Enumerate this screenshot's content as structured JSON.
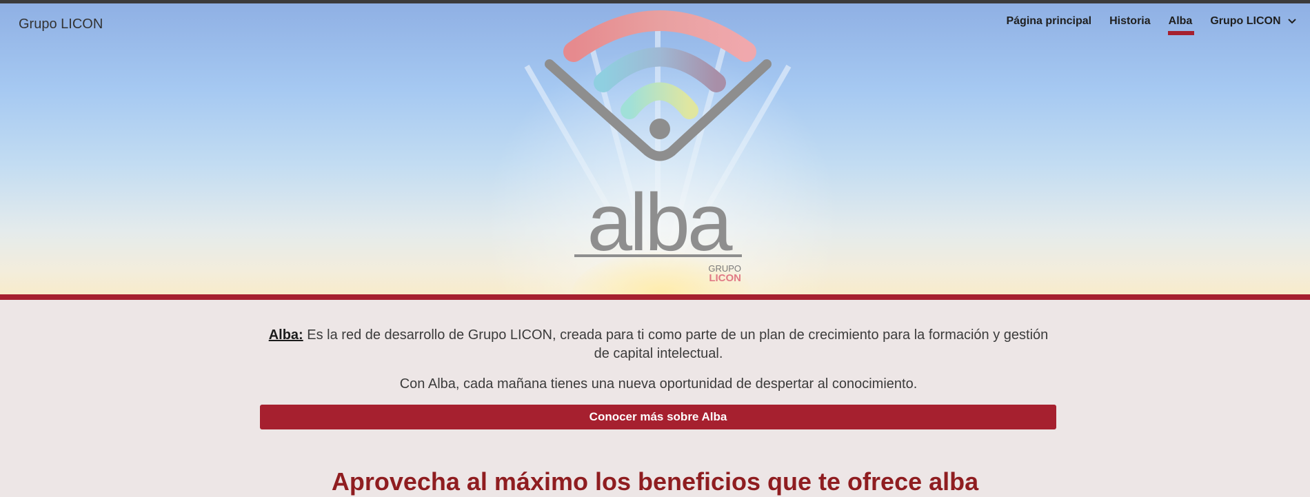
{
  "header": {
    "brand": "Grupo LICON",
    "nav": [
      {
        "label": "Página principal"
      },
      {
        "label": "Historia"
      },
      {
        "label": "Alba",
        "active": true
      },
      {
        "label": "Grupo LICON",
        "has_dropdown": true
      }
    ]
  },
  "hero": {
    "logo_word": "alba",
    "logo_sub_top": "GRUPO",
    "logo_sub_bottom": "LICON"
  },
  "intro": {
    "alba_label": "Alba:",
    "text": " Es la red de desarrollo de Grupo LICON, creada para ti como parte de un plan de crecimiento para la formación y gestión de capital intelectual.",
    "text2": "Con Alba, cada mañana tienes una nueva oportunidad de despertar al conocimiento."
  },
  "cta": {
    "label": "Conocer más sobre Alba"
  },
  "section": {
    "title": "Aprovecha al máximo los beneficios que te ofrece alba"
  },
  "colors": {
    "accent": "#a6202f",
    "title": "#8f1d20"
  }
}
